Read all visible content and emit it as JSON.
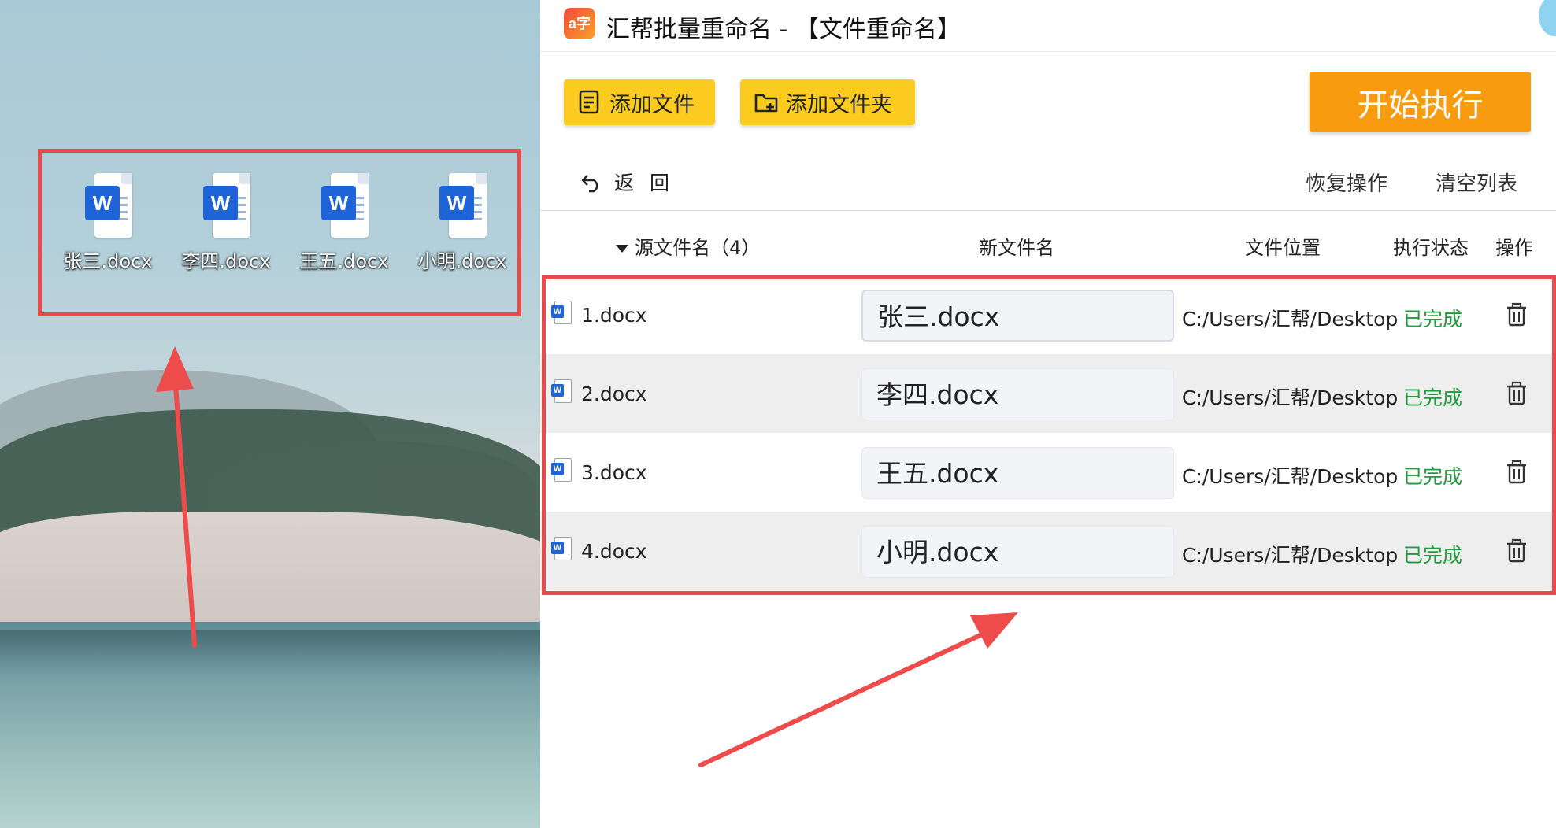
{
  "desktop": {
    "files": [
      {
        "name": "张三.docx"
      },
      {
        "name": "李四.docx"
      },
      {
        "name": "王五.docx"
      },
      {
        "name": "小明.docx"
      }
    ],
    "word_badge": "W"
  },
  "app": {
    "logo_text": "a字",
    "title": "汇帮批量重命名 - 【文件重命名】",
    "toolbar": {
      "add_file": "添加文件",
      "add_folder": "添加文件夹",
      "start": "开始执行"
    },
    "nav": {
      "back": "返回",
      "restore": "恢复操作",
      "clear": "清空列表"
    },
    "table": {
      "headers": {
        "source": "源文件名（4）",
        "new_name": "新文件名",
        "location": "文件位置",
        "status": "执行状态",
        "action": "操作"
      },
      "rows": [
        {
          "source": "1.docx",
          "new_name": "张三.docx",
          "location": "C:/Users/汇帮/Desktop",
          "status": "已完成"
        },
        {
          "source": "2.docx",
          "new_name": "李四.docx",
          "location": "C:/Users/汇帮/Desktop",
          "status": "已完成"
        },
        {
          "source": "3.docx",
          "new_name": "王五.docx",
          "location": "C:/Users/汇帮/Desktop",
          "status": "已完成"
        },
        {
          "source": "4.docx",
          "new_name": "小明.docx",
          "location": "C:/Users/汇帮/Desktop",
          "status": "已完成"
        }
      ]
    }
  },
  "colors": {
    "highlight_red": "#e74c4c",
    "button_yellow": "#fccb1f",
    "start_orange": "#f99b0f",
    "status_green": "#1f9d3a",
    "word_blue": "#1f63d8"
  }
}
